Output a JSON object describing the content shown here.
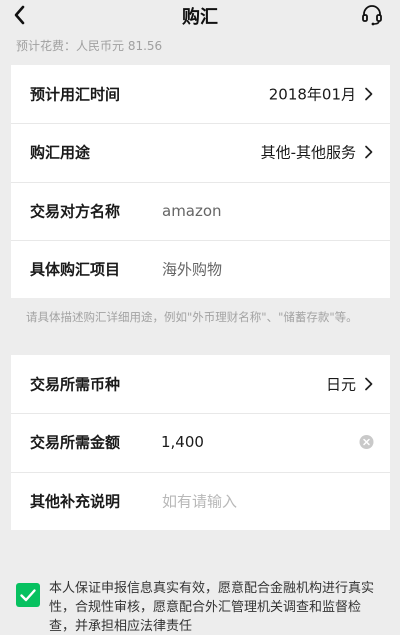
{
  "nav": {
    "title": "购汇",
    "back_icon": "chevron-left-icon",
    "service_icon": "customer-service-headset-icon"
  },
  "estimate": {
    "text": "预计花费：人民币元 81.56"
  },
  "form_section_1": {
    "rows": [
      {
        "label": "预计用汇时间",
        "value": "2018年01月"
      },
      {
        "label": "购汇用途",
        "value": "其他-其他服务"
      },
      {
        "label": "交易对方名称",
        "value": "amazon"
      },
      {
        "label": "具体购汇项目",
        "value": "海外购物"
      }
    ]
  },
  "hint": {
    "text": "请具体描述购汇详细用途，例如\"外币理财名称\"、\"储蓄存款\"等。"
  },
  "form_section_2": {
    "rows": [
      {
        "label": "交易所需币种",
        "value": "日元"
      },
      {
        "label": "交易所需金额",
        "value": "1,400"
      },
      {
        "label": "其他补充说明",
        "placeholder": "如有请输入"
      }
    ]
  },
  "agreement": {
    "checked": true,
    "text": "本人保证申报信息真实有效，愿意配合金融机构进行真实性，合规性审核，愿意配合外汇管理机关调查和监督检查，并承担相应法律责任"
  },
  "colors": {
    "accent_green": "#07c160",
    "background": "#ededed"
  }
}
